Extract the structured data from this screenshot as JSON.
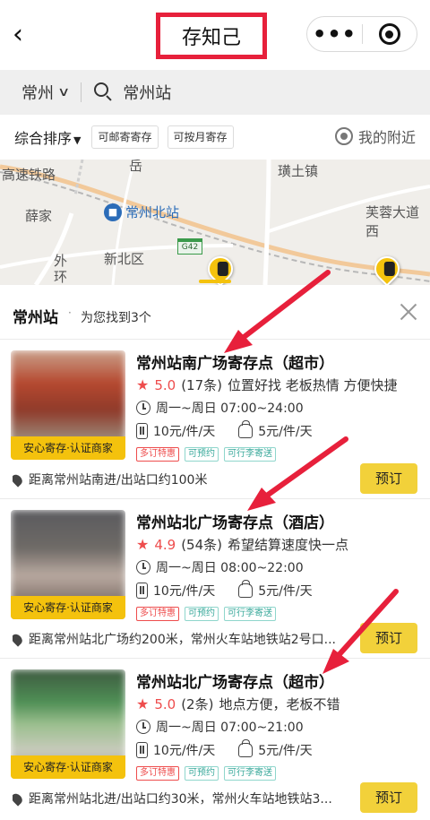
{
  "header": {
    "title": "存知己",
    "back_icon": "chevron-left-icon",
    "more_icon": "more-dots-icon",
    "close_icon": "target-close-icon",
    "highlight_color": "#e7203b"
  },
  "search": {
    "city": "常州",
    "query": "常州站"
  },
  "filters": {
    "sort_label": "综合排序",
    "chips": [
      "可邮寄寄存",
      "可按月寄存"
    ],
    "nearby_label": "我的附近"
  },
  "map": {
    "labels": {
      "railway": "高速铁路",
      "road": "岳",
      "town": "璜土镇",
      "avenue": "芙蓉大道西",
      "village": "薛家",
      "station": "常州北站",
      "district": "新北区",
      "ring": "外环",
      "highway": "G42"
    },
    "marker_color": "#f4c20d"
  },
  "results": {
    "station": "常州站",
    "separator": "·",
    "count_text": "为您找到3个"
  },
  "cards": [
    {
      "name": "常州站南广场寄存点（超市）",
      "score": "5.0",
      "reviews": "(17条)",
      "comment": "位置好找 老板热情 方便快捷",
      "hours": "周一~周日 07:00~24:00",
      "price_luggage": "10元/件/天",
      "price_bag": "5元/件/天",
      "badge": "安心寄存·认证商家",
      "tags": [
        "多订特惠",
        "可预约",
        "可行李寄送"
      ],
      "address": "距离常州站南进/出站口约100米",
      "button": "预订"
    },
    {
      "name": "常州站北广场寄存点（酒店）",
      "score": "4.9",
      "reviews": "(54条)",
      "comment": "希望结算速度快一点",
      "hours": "周一~周日 08:00~22:00",
      "price_luggage": "10元/件/天",
      "price_bag": "5元/件/天",
      "badge": "安心寄存·认证商家",
      "tags": [
        "多订特惠",
        "可预约",
        "可行李寄送"
      ],
      "address": "距离常州站北广场约200米，常州火车站地铁站2号口...",
      "button": "预订"
    },
    {
      "name": "常州站北广场寄存点（超市）",
      "score": "5.0",
      "reviews": "(2条)",
      "comment": "地点方便，老板不错",
      "hours": "周一~周日 07:00~21:00",
      "price_luggage": "10元/件/天",
      "price_bag": "5元/件/天",
      "badge": "安心寄存·认证商家",
      "tags": [
        "多订特惠",
        "可预约",
        "可行李寄送"
      ],
      "address": "距离常州站北进/出站口约30米，常州火车站地铁站3...",
      "button": "预订"
    }
  ]
}
